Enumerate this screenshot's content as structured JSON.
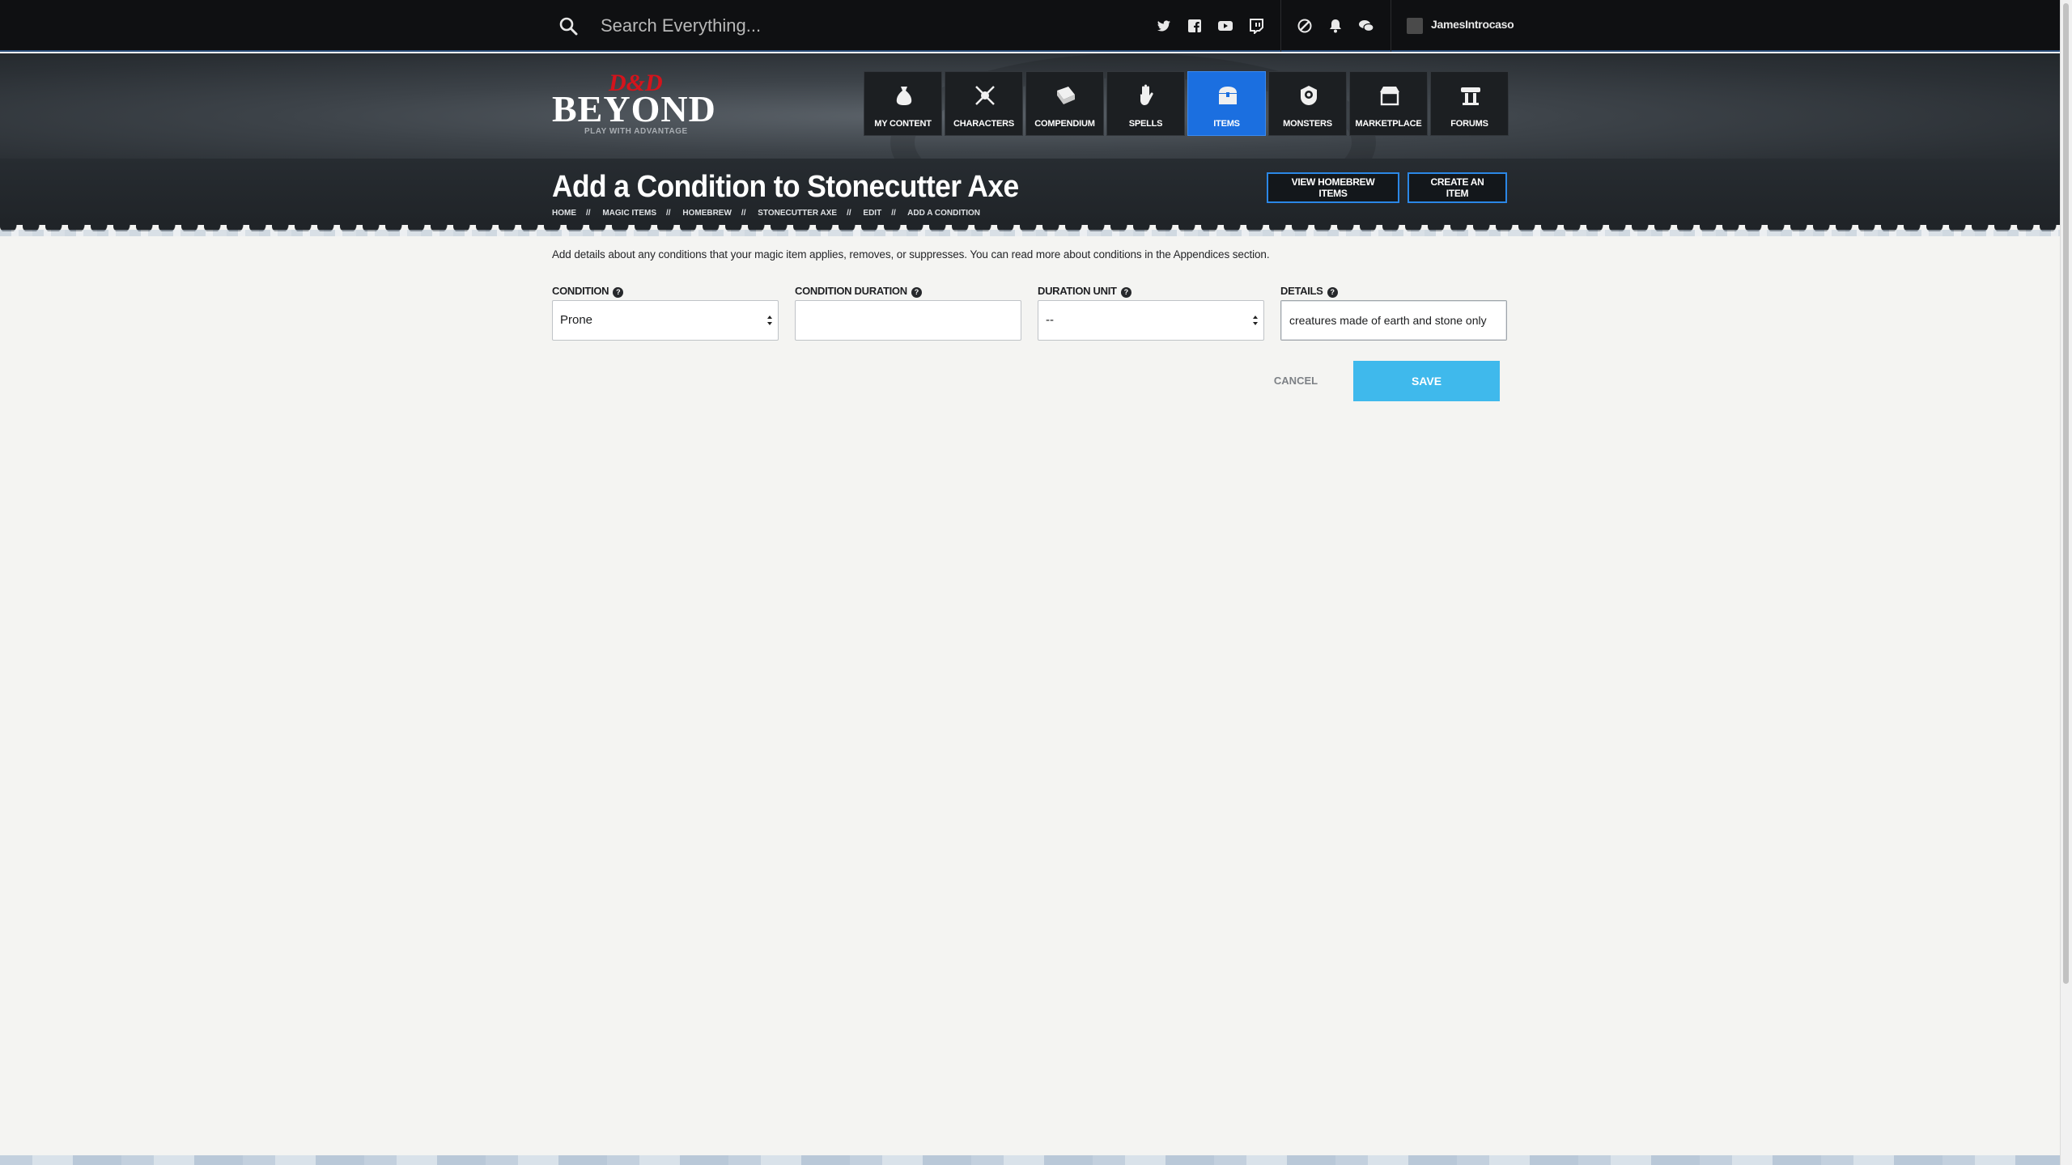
{
  "topbar": {
    "search_placeholder": "Search Everything...",
    "social_icons": [
      "twitter-icon",
      "facebook-icon",
      "youtube-icon",
      "twitch-icon"
    ],
    "util_icons": [
      "sync-icon",
      "bell-icon",
      "chat-icon"
    ],
    "username": "JamesIntrocaso"
  },
  "logo": {
    "mark": "D&D",
    "name": "BEYOND",
    "tagline": "PLAY WITH ADVANTAGE"
  },
  "nav": {
    "items": [
      {
        "label": "MY CONTENT",
        "icon": "bag-icon"
      },
      {
        "label": "CHARACTERS",
        "icon": "crossed-swords-icon"
      },
      {
        "label": "COMPENDIUM",
        "icon": "book-icon"
      },
      {
        "label": "SPELLS",
        "icon": "hand-icon"
      },
      {
        "label": "ITEMS",
        "icon": "chest-icon"
      },
      {
        "label": "MONSTERS",
        "icon": "monster-icon"
      },
      {
        "label": "MARKETPLACE",
        "icon": "shop-icon"
      },
      {
        "label": "FORUMS",
        "icon": "forum-icon"
      }
    ],
    "active": "ITEMS",
    "active_color": "#1b6fe0"
  },
  "page": {
    "title": "Add a Condition to Stonecutter Axe",
    "breadcrumb": [
      "HOME",
      "MAGIC ITEMS",
      "HOMEBREW",
      "STONECUTTER AXE",
      "EDIT",
      "ADD A CONDITION"
    ],
    "breadcrumb_sep": "//",
    "view_homebrew_label": "VIEW HOMEBREW ITEMS",
    "create_item_label": "CREATE AN ITEM"
  },
  "form": {
    "intro": "Add details about any conditions that your magic item applies, removes, or suppresses. You can read more about conditions in the Appendices section.",
    "condition_label": "CONDITION",
    "condition_value": "Prone",
    "duration_label": "CONDITION DURATION",
    "duration_value": "",
    "duration_unit_label": "DURATION UNIT",
    "duration_unit_value": "--",
    "details_label": "DETAILS",
    "details_value": "creatures made of earth and stone only",
    "help_glyph": "?",
    "cancel_label": "CANCEL",
    "save_label": "SAVE",
    "save_color": "#3fb9ec"
  }
}
